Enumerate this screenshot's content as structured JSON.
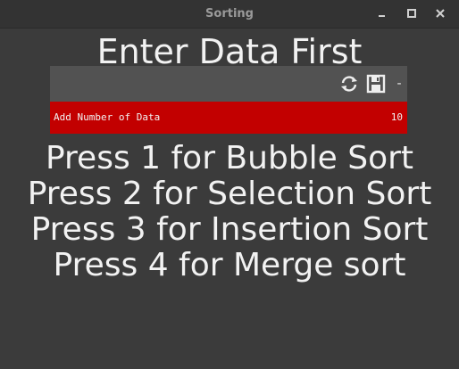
{
  "window": {
    "title": "Sorting",
    "controls": [
      "minimize",
      "maximize",
      "close"
    ]
  },
  "heading": "Enter Data First",
  "panel": {
    "tools": [
      "refresh-icon",
      "save-icon",
      "collapse-icon"
    ],
    "collapse_label": "-",
    "row": {
      "label": "Add Number of Data",
      "value": "10"
    }
  },
  "instructions": [
    "Press 1 for Bubble Sort",
    "Press 2 for Selection Sort",
    "Press 3 for Insertion Sort",
    "Press 4 for Merge sort"
  ],
  "colors": {
    "background": "#3b3b3b",
    "titlebar": "#333333",
    "panel_header": "#525252",
    "row_accent": "#c20000",
    "text": "#f2f2f2"
  }
}
